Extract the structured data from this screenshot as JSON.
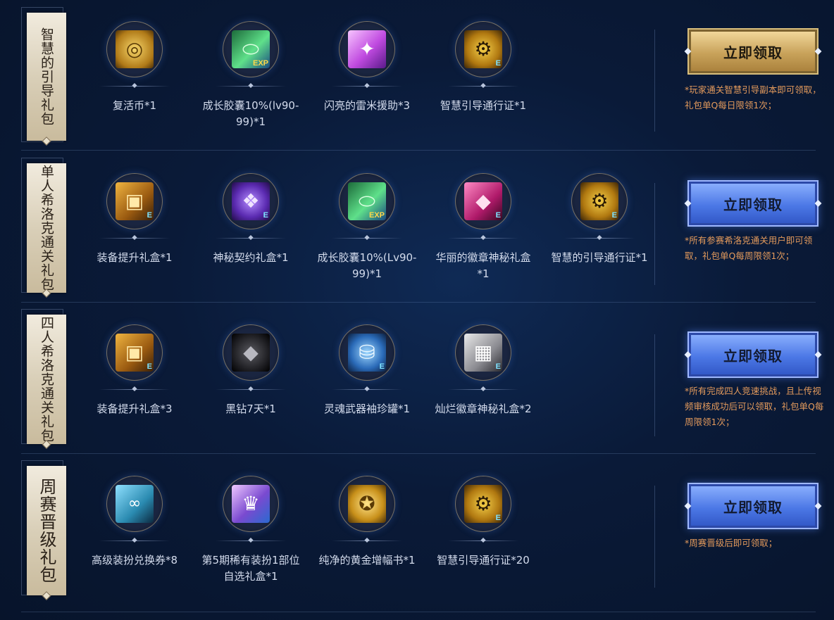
{
  "colors": {
    "note": "#e39a5c",
    "banner_bg": "#e2d8c2",
    "gold_button": "#c8a25a",
    "blue_button": "#4c78e6"
  },
  "packs": [
    {
      "title": "智慧的引导礼包",
      "button_label": "立即领取",
      "button_style": "gold",
      "note": "*玩家通关智慧引导副本即可领取，礼包单Q每日限领1次；",
      "items": [
        {
          "label": "复活币*1",
          "icon": "gold-coin-icon"
        },
        {
          "label": "成长胶囊10%(lv90-99)*1",
          "icon": "exp-capsule-icon"
        },
        {
          "label": "闪亮的雷米援助*3",
          "icon": "pink-sparkle-icon"
        },
        {
          "label": "智慧引导通行证*1",
          "icon": "free-pass-gear-icon"
        }
      ]
    },
    {
      "title": "单人希洛克通关礼包",
      "button_label": "立即领取",
      "button_style": "blue",
      "note": "*所有参赛希洛克通关用户即可领取，礼包单Q每周限领1次；",
      "items": [
        {
          "label": "装备提升礼盒*1",
          "icon": "gold-chest-icon"
        },
        {
          "label": "神秘契约礼盒*1",
          "icon": "purple-pouch-icon"
        },
        {
          "label": "成长胶囊10%(Lv90-99)*1",
          "icon": "exp-capsule-icon"
        },
        {
          "label": "华丽的徽章神秘礼盒*1",
          "icon": "pink-emblem-box-icon"
        },
        {
          "label": "智慧的引导通行证*1",
          "icon": "free-pass-gear-icon"
        }
      ]
    },
    {
      "title": "四人希洛克通关礼包",
      "button_label": "立即领取",
      "button_style": "blue",
      "note": "*所有完成四人竞速挑战，且上传视频审核成功后可以领取，礼包单Q每周限领1次；",
      "items": [
        {
          "label": "装备提升礼盒*3",
          "icon": "gold-chest-icon"
        },
        {
          "label": "黑钻7天*1",
          "icon": "black-diamond-icon"
        },
        {
          "label": "灵魂武器袖珍罐*1",
          "icon": "blue-jar-icon"
        },
        {
          "label": "灿烂徽章神秘礼盒*2",
          "icon": "white-emblem-box-icon"
        }
      ]
    },
    {
      "title": "周赛晋级礼包",
      "button_label": "立即领取",
      "button_style": "blue",
      "note": "*周赛晋级后即可领取；",
      "items": [
        {
          "label": "高级装扮兑换券*8",
          "icon": "avatar-ticket-icon"
        },
        {
          "label": "第5期稀有装扮1部位自选礼盒*1",
          "icon": "rare-avatar-box-icon"
        },
        {
          "label": "纯净的黄金增幅书*1",
          "icon": "gold-amplify-book-icon"
        },
        {
          "label": "智慧引导通行证*20",
          "icon": "free-pass-gear-icon"
        }
      ]
    }
  ]
}
